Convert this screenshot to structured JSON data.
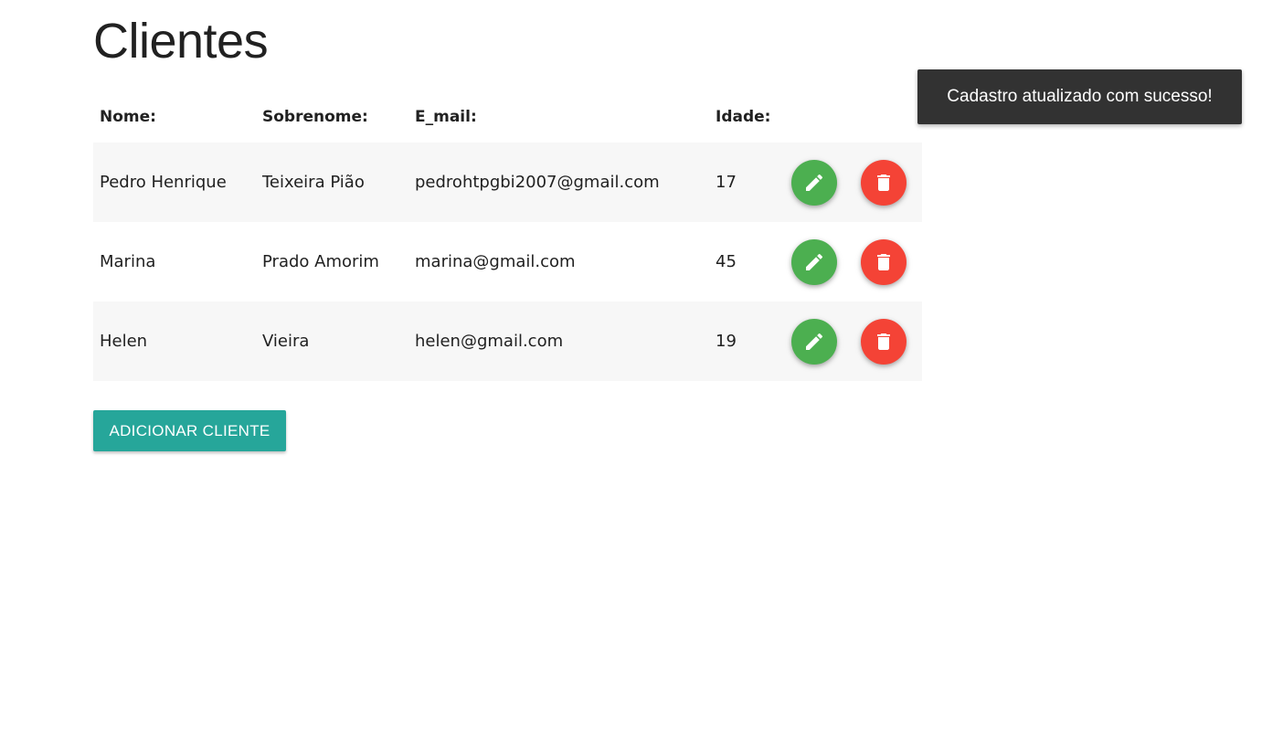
{
  "page": {
    "title": "Clientes"
  },
  "table": {
    "headers": [
      "Nome:",
      "Sobrenome:",
      "E_mail:",
      "Idade:"
    ],
    "rows": [
      {
        "nome": "Pedro Henrique",
        "sobrenome": "Teixeira Pião",
        "email": "pedrohtpgbi2007@gmail.com",
        "idade": "17"
      },
      {
        "nome": "Marina",
        "sobrenome": "Prado Amorim",
        "email": "marina@gmail.com",
        "idade": "45"
      },
      {
        "nome": "Helen",
        "sobrenome": "Vieira",
        "email": "helen@gmail.com",
        "idade": "19"
      }
    ],
    "row_actions": {
      "edit_icon": "pencil-icon",
      "delete_icon": "trash-icon"
    }
  },
  "actions": {
    "add_label": "ADICIONAR CLIENTE"
  },
  "toast": {
    "message": "Cadastro atualizado com sucesso!"
  },
  "colors": {
    "edit": "#4caf50",
    "delete": "#f44336",
    "primary": "#26a69a",
    "toast_bg": "#323232",
    "row_stripe": "#f7f7f7"
  }
}
